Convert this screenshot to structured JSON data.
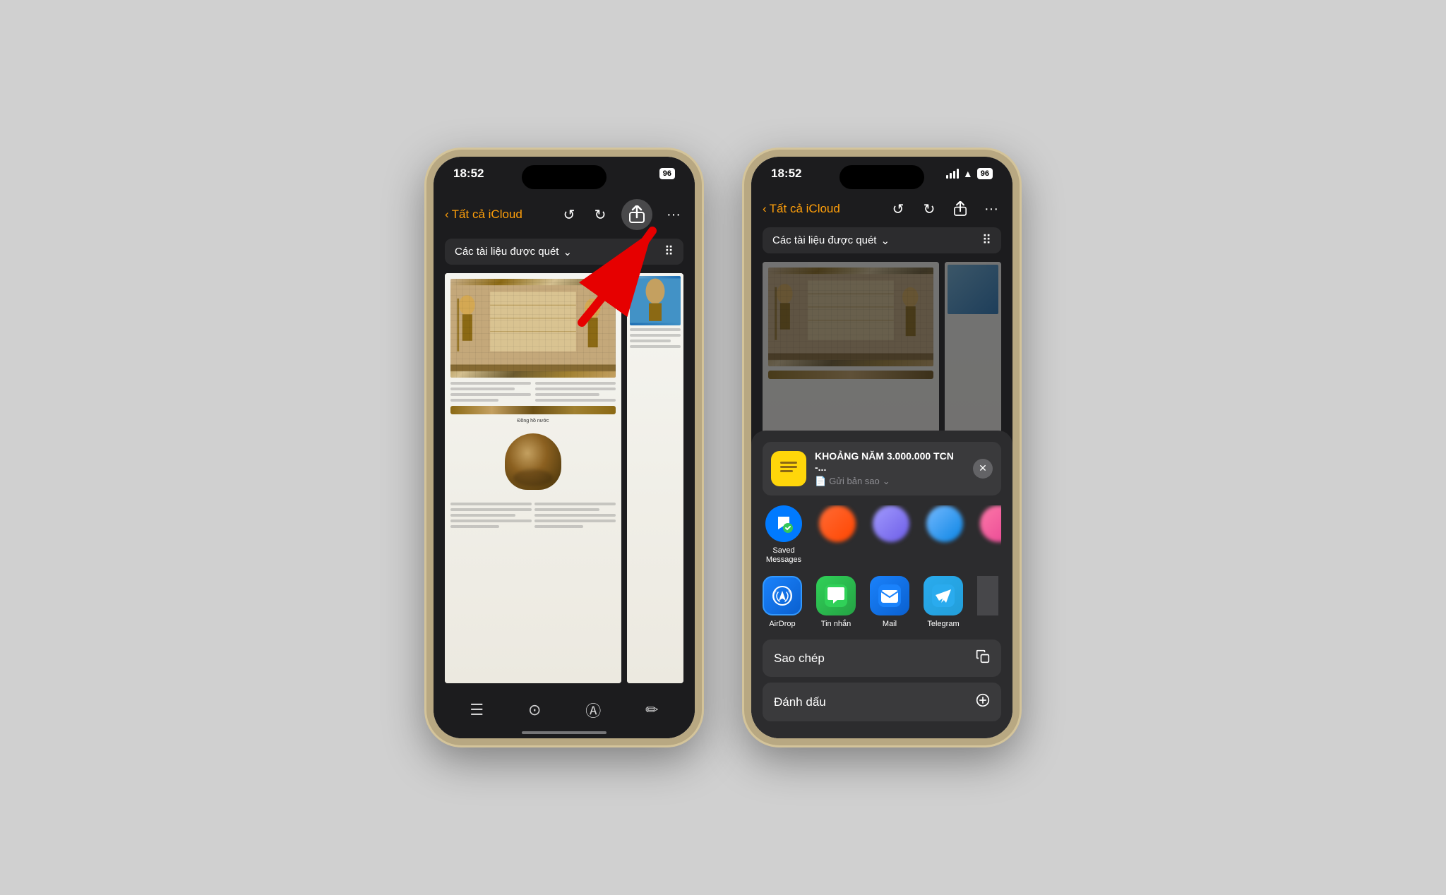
{
  "left_phone": {
    "status": {
      "time": "18:52",
      "battery": "96"
    },
    "nav": {
      "back_label": "Tất cả iCloud",
      "folder_title": "Các tài liệu được quét"
    },
    "bottom_toolbar": {
      "icons": [
        "checklist",
        "camera",
        "a-circle",
        "square-pencil"
      ]
    }
  },
  "right_phone": {
    "status": {
      "time": "18:52",
      "battery": "96"
    },
    "nav": {
      "back_label": "Tất cả iCloud",
      "folder_title": "Các tài liệu được quét"
    },
    "share_sheet": {
      "app_icon": "📝",
      "title": "KHOẢNG NĂM 3.000.000 TCN -...",
      "subtitle": "Gửi bản sao",
      "close_label": "✕",
      "people": [
        {
          "name": "Saved\nMessages",
          "type": "saved-msg",
          "icon": "🔖"
        },
        {
          "name": "",
          "type": "blurred1"
        },
        {
          "name": "",
          "type": "blurred2"
        },
        {
          "name": "",
          "type": "blurred3"
        },
        {
          "name": "",
          "type": "blurred4"
        }
      ],
      "apps": [
        {
          "name": "AirDrop",
          "type": "airdrop",
          "icon": "📡"
        },
        {
          "name": "Tin nhắn",
          "type": "messages",
          "icon": "💬"
        },
        {
          "name": "Mail",
          "type": "mail",
          "icon": "✉️"
        },
        {
          "name": "Telegram",
          "type": "telegram",
          "icon": "✈️"
        }
      ],
      "actions": [
        {
          "label": "Sao chép",
          "icon": "⎘"
        },
        {
          "label": "Đánh dấu",
          "icon": "Ⓐ"
        }
      ]
    }
  }
}
